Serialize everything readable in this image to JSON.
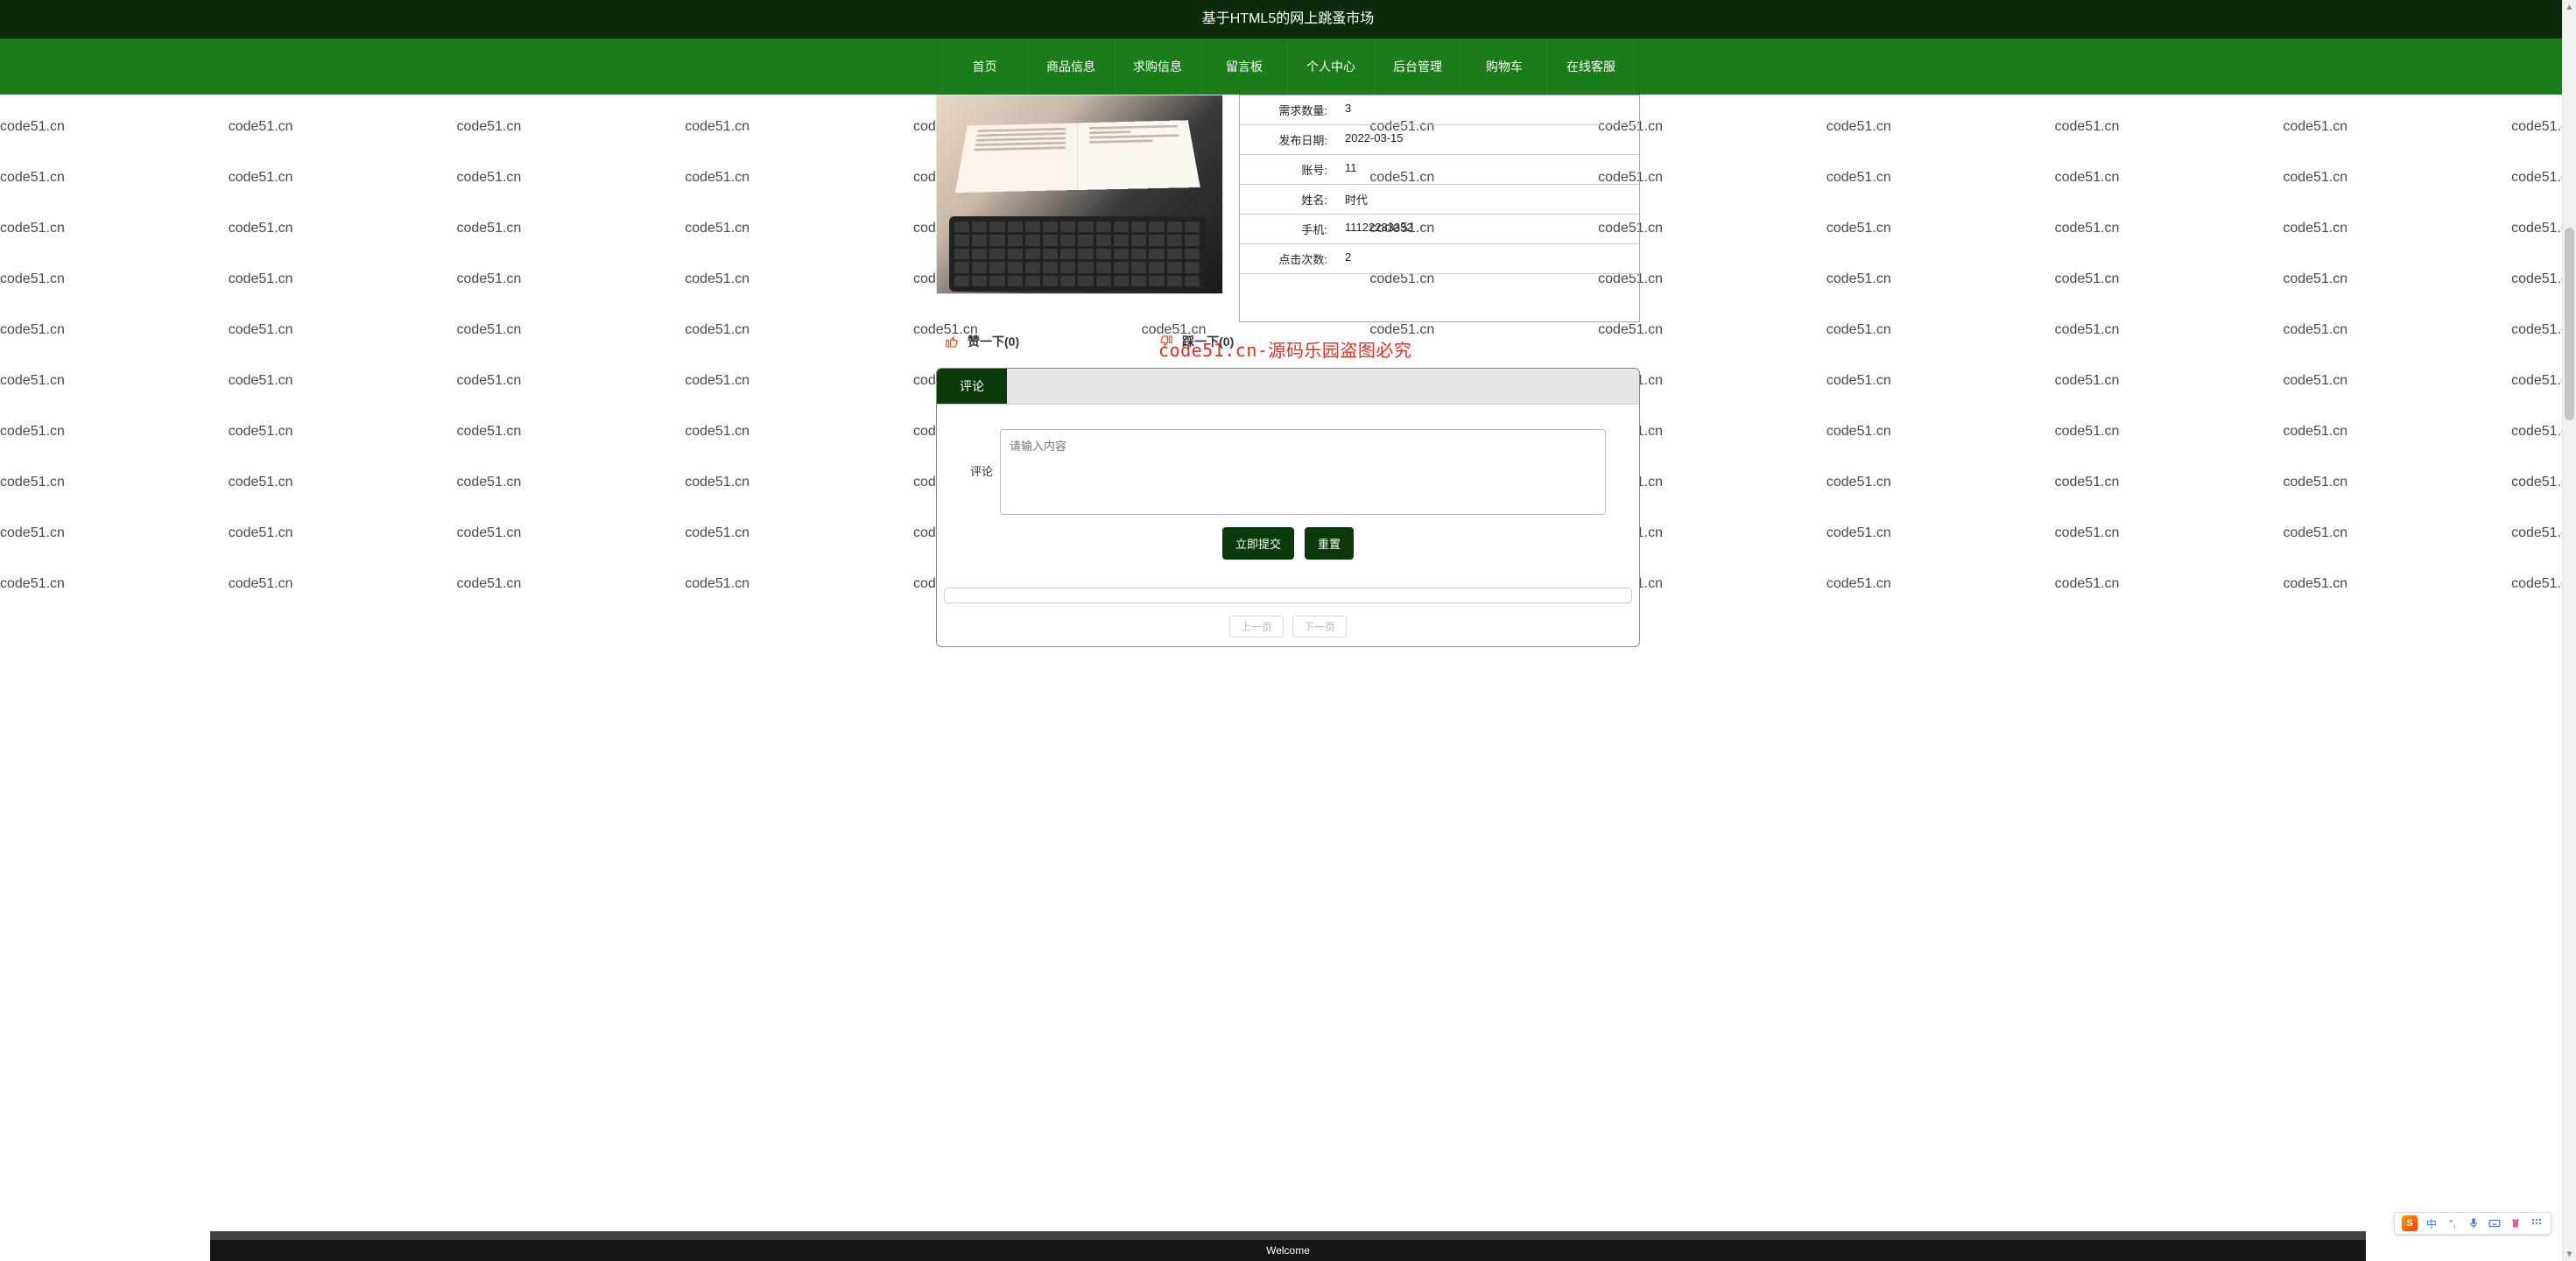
{
  "watermark_text": "code51.cn",
  "header": {
    "title": "基于HTML5的网上跳蚤市场"
  },
  "nav": {
    "items": [
      {
        "label": "首页"
      },
      {
        "label": "商品信息"
      },
      {
        "label": "求购信息"
      },
      {
        "label": "留言板"
      },
      {
        "label": "个人中心"
      },
      {
        "label": "后台管理"
      },
      {
        "label": "购物车"
      },
      {
        "label": "在线客服"
      }
    ]
  },
  "details": {
    "rows": [
      {
        "label": "需求数量:",
        "value": "3"
      },
      {
        "label": "发布日期:",
        "value": "2022-03-15"
      },
      {
        "label": "账号:",
        "value": "11"
      },
      {
        "label": "姓名:",
        "value": "时代"
      },
      {
        "label": "手机:",
        "value": "11122233332"
      },
      {
        "label": "点击次数:",
        "value": "2"
      }
    ]
  },
  "vote": {
    "like_label": "赞一下(0)",
    "dislike_label": "踩一下(0)"
  },
  "red_watermark": "code51.cn-源码乐园盗图必究",
  "comment": {
    "tab_label": "评论",
    "form_label": "评论",
    "placeholder": "请输入内容",
    "submit_label": "立即提交",
    "reset_label": "重置",
    "prev_label": "上一页",
    "next_label": "下一页"
  },
  "footer": {
    "text": "Welcome"
  },
  "ime": {
    "logo_letter": "S",
    "lang_label": "中"
  }
}
